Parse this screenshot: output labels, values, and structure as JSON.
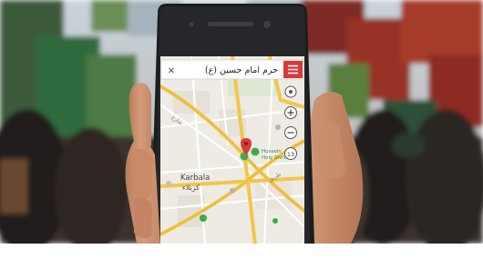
{
  "search": {
    "value": "حرم امام حسین (ع)",
    "close_glyph": "×"
  },
  "map": {
    "city_label_en": "Karbala",
    "city_label_ar": "كربلاء",
    "poi_label_line1": "Hussein",
    "poi_label_line2": "Holy Shrine",
    "zoom_level": "13",
    "road_labels": [
      "شارع",
      "طريق"
    ]
  },
  "icons": {
    "menu": "hamburger-menu-icon",
    "close": "close-icon",
    "locate": "my-location-icon",
    "zoom_in": "plus-icon",
    "zoom_out": "minus-icon",
    "pin": "map-pin-icon"
  },
  "colors": {
    "menu_red": "#d9383a",
    "pin_red": "#d93a36",
    "poi_green": "#45a84a",
    "road_yellow": "#f3c64a",
    "map_bg": "#eeebe4",
    "phone_body": "#1c1d20"
  }
}
